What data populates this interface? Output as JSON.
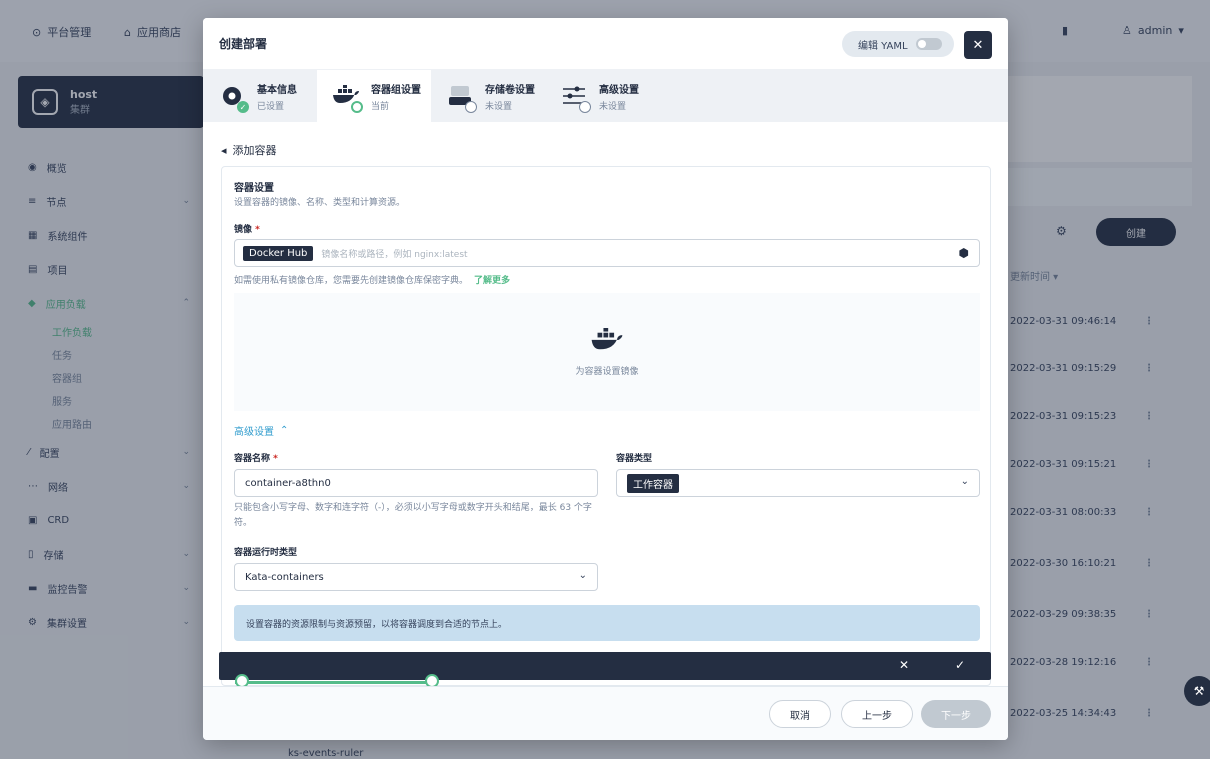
{
  "topbar": {
    "platform": "平台管理",
    "appstore": "应用商店",
    "user": "admin"
  },
  "cluster": {
    "name": "host",
    "type": "集群"
  },
  "nav": {
    "items": [
      {
        "label": "概览"
      },
      {
        "label": "节点"
      },
      {
        "label": "系统组件"
      },
      {
        "label": "项目"
      },
      {
        "label": "应用负载"
      }
    ],
    "subs": [
      "工作负载",
      "任务",
      "容器组",
      "服务",
      "应用路由"
    ],
    "items2": [
      {
        "label": "配置"
      },
      {
        "label": "网络"
      },
      {
        "label": "CRD"
      },
      {
        "label": "存储"
      },
      {
        "label": "监控告警"
      },
      {
        "label": "集群设置"
      }
    ]
  },
  "bgtable": {
    "create": "创建",
    "sort_header": "更新时间",
    "rows": [
      "2022-03-31 09:46:14",
      "2022-03-31 09:15:29",
      "2022-03-31 09:15:23",
      "2022-03-31 09:15:21",
      "2022-03-31 08:00:33",
      "2022-03-30 16:10:21",
      "2022-03-29 09:38:35",
      "2022-03-28 19:12:16",
      "2022-03-25 14:34:43"
    ],
    "peek": "ks-events-ruler"
  },
  "modal": {
    "title": "创建部署",
    "yaml_label": "编辑 YAML",
    "tabs": [
      {
        "title": "基本信息",
        "status": "已设置"
      },
      {
        "title": "容器组设置",
        "status": "当前"
      },
      {
        "title": "存储卷设置",
        "status": "未设置"
      },
      {
        "title": "高级设置",
        "status": "未设置"
      }
    ],
    "back": "添加容器",
    "section_title": "容器设置",
    "section_desc": "设置容器的镜像、名称、类型和计算资源。",
    "image_label": "镜像",
    "registry": "Docker Hub",
    "image_placeholder": "镜像名称或路径，例如 nginx:latest",
    "hint_private": "如需使用私有镜像仓库，您需要先创建镜像仓库保密字典。",
    "learn_more": "了解更多",
    "empty_text": "为容器设置镜像",
    "advanced": "高级设置",
    "name_label": "容器名称",
    "name_value": "container-a8thn0",
    "type_label": "容器类型",
    "type_value": "工作容器",
    "name_hint": "只能包含小写字母、数字和连字符（-），必须以小写字母或数字开头和结尾，最长 63 个字符。",
    "runtime_label": "容器运行时类型",
    "runtime_value": "Kata-containers",
    "info": "设置容器的资源限制与资源预留，以将容器调度到合适的节点上。",
    "cancel": "取消",
    "prev": "上一步",
    "next": "下一步"
  }
}
